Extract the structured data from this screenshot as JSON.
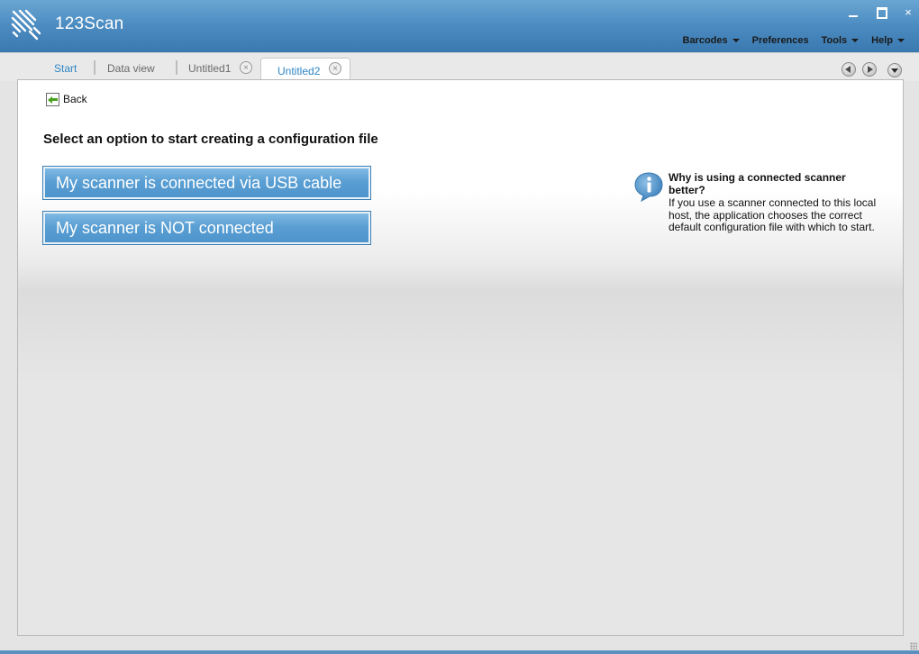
{
  "app": {
    "title": "123Scan",
    "brand_color": "#4b8bc0"
  },
  "window_controls": {
    "minimize": "minimize-icon",
    "maximize": "maximize-icon",
    "close": "×"
  },
  "menu": [
    {
      "label": "Barcodes",
      "has_dropdown": true
    },
    {
      "label": "Preferences",
      "has_dropdown": false
    },
    {
      "label": "Tools",
      "has_dropdown": true
    },
    {
      "label": "Help",
      "has_dropdown": true
    }
  ],
  "tabs": {
    "start": "Start",
    "data_view": "Data view",
    "untitled1": "Untitled1",
    "untitled2": "Untitled2",
    "close_glyph": "×",
    "active": "Untitled2",
    "active_color": "#2f86c4"
  },
  "content": {
    "back_label": "Back",
    "heading": "Select an option to start creating a configuration file",
    "options": {
      "usb": "My scanner is connected via USB cable",
      "not_connected": "My scanner is NOT connected"
    },
    "info": {
      "title": "Why is using a connected scanner better?",
      "body": "If you use a scanner connected to this local host, the application chooses the correct default configuration file with which to start."
    }
  }
}
